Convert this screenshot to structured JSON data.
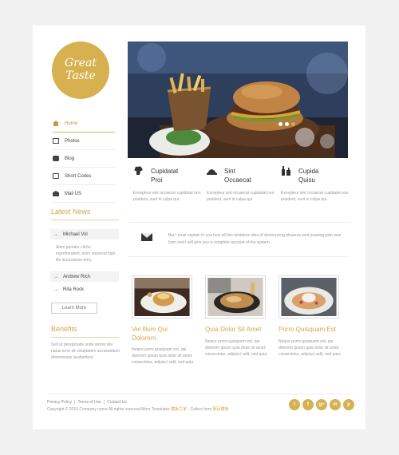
{
  "logo": {
    "line1": "Great",
    "line2": "Taste"
  },
  "nav": [
    {
      "label": "Home",
      "icon": "house-icon",
      "active": true
    },
    {
      "label": "Photos",
      "icon": "photo-icon"
    },
    {
      "label": "Blog",
      "icon": "blog-icon"
    },
    {
      "label": "Short Codes",
      "icon": "code-icon"
    },
    {
      "label": "Mail US",
      "icon": "mail-icon"
    }
  ],
  "latest_news": {
    "heading": "Latest News",
    "items": [
      "Michael Vol",
      "Andrew Rich",
      "Rita Rock"
    ],
    "text": "Anim pariatur cliche reprehenderit, enim eiusmod high life accusamus terry.",
    "button": "Learn More"
  },
  "benefits": {
    "heading": "Benefits",
    "text": "Sed ut perspiciatis unde omnis iste natus error sit voluptatem accusantium doloremque laudantium."
  },
  "slider": {
    "dots": 3,
    "active_dot": 2
  },
  "features": [
    {
      "title_1": "Cupidatat",
      "title_2": "Proi",
      "text": "Excepteur sint occaecat cupidatat non proident, sunt in culpa qui.",
      "icon": "chef-icon"
    },
    {
      "title_1": "Sint",
      "title_2": "Occaecat",
      "text": "Excepteur sint occaecat cupidatat non proident, sunt in culpa qui.",
      "icon": "dish-icon"
    },
    {
      "title_1": "Cupida",
      "title_2": "Quisu",
      "text": "Excepteur sint occaecat cupidatat non proident, sunt in culpa qui.",
      "icon": "bottles-icon"
    }
  ],
  "quote": {
    "text": "But I must explain to you how all this mistaken idea of denouncing pleasure and praising pain was born and I will give you a complete account of the system.",
    "icon": "envelope-icon"
  },
  "cards": [
    {
      "title_1": "Vel Illum Qui",
      "title_2": "Dolorem",
      "text": "Neque porro quisquam est, qui dolorem ipsum quia dolor sit amet, consectetur, adipisci velit, sed quia."
    },
    {
      "title_1": "Quia Dolor Sit Amet",
      "title_2": "",
      "text": "Neque porro quisquam est, qui dolorem ipsum quia dolor sit amet, consectetur, adipisci velit, sed quia."
    },
    {
      "title_1": "Porro Quisquam Est",
      "title_2": "",
      "text": "Neque porro quisquam est, qui dolorem ipsum quia dolor sit amet, consectetur, adipisci velit, sed quia."
    }
  ],
  "footer": {
    "links": [
      "Privacy Policy",
      "Terms of Use",
      "Contact Us"
    ],
    "separator": "|",
    "copyright": "Copyright © 2016.Company name All rights reserved.More Templates",
    "brand1": "模板之家",
    "collect": " - Collect from",
    "brand2": "网页模板"
  },
  "socials": [
    {
      "label": "t",
      "icon": "twitter-icon"
    },
    {
      "label": "f",
      "icon": "facebook-icon"
    },
    {
      "label": "g+",
      "icon": "google-plus-icon"
    },
    {
      "label": "in",
      "icon": "linkedin-icon"
    },
    {
      "label": "p",
      "icon": "pinterest-icon"
    }
  ],
  "colors": {
    "accent": "#d7b14f",
    "heading_gold": "#d4a84a",
    "background": "#f1f1f1"
  }
}
